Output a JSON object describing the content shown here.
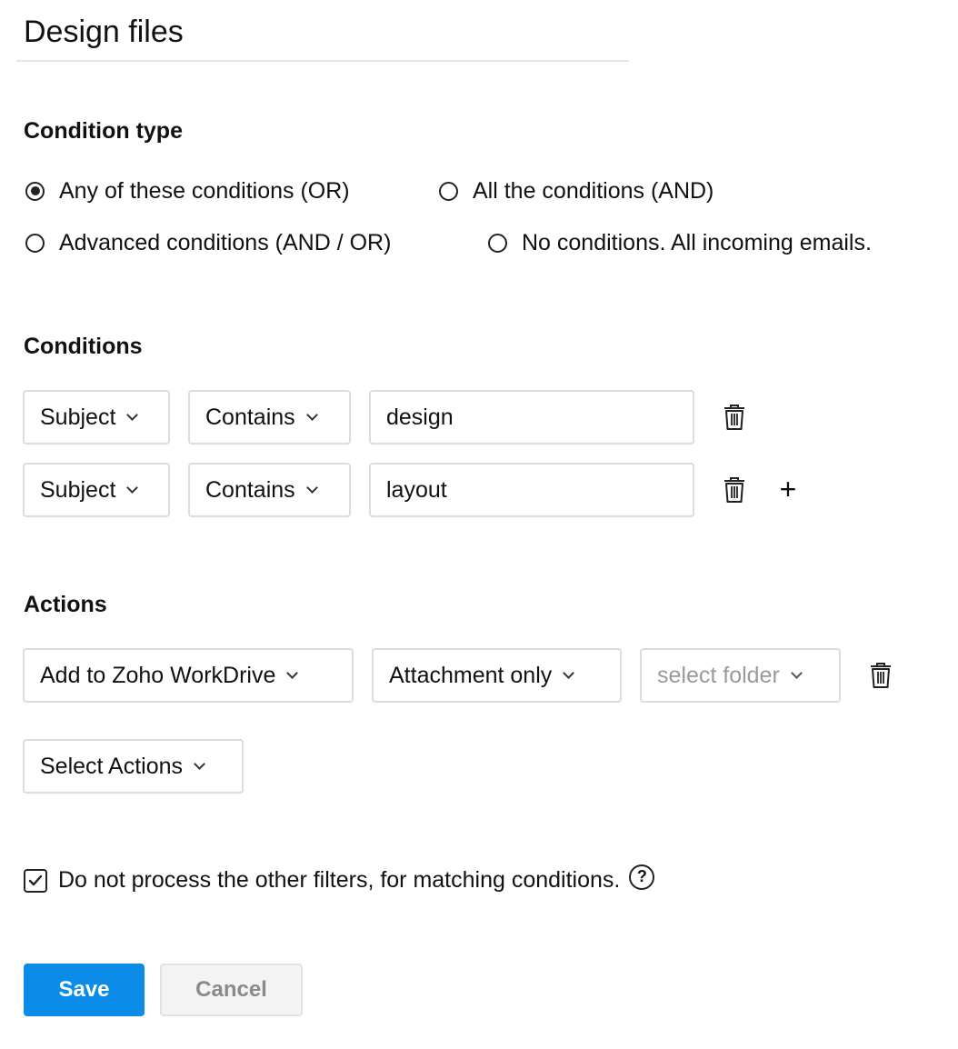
{
  "filter": {
    "name": "Design files"
  },
  "condition_type": {
    "title": "Condition type",
    "options": [
      {
        "label": "Any of these conditions (OR)",
        "checked": true
      },
      {
        "label": "All the conditions (AND)",
        "checked": false
      },
      {
        "label": "Advanced conditions (AND / OR)",
        "checked": false
      },
      {
        "label": "No conditions. All incoming emails.",
        "checked": false
      }
    ]
  },
  "conditions": {
    "title": "Conditions",
    "rows": [
      {
        "field": "Subject",
        "operator": "Contains",
        "value": "design"
      },
      {
        "field": "Subject",
        "operator": "Contains",
        "value": "layout"
      }
    ],
    "add_symbol": "+"
  },
  "actions": {
    "title": "Actions",
    "rows": [
      {
        "action": "Add to Zoho WorkDrive",
        "option": "Attachment only",
        "folder_placeholder": "select folder"
      }
    ],
    "select_label": "Select Actions"
  },
  "stop_processing": {
    "label": "Do not process the other filters, for matching conditions.",
    "checked": true,
    "help_symbol": "?"
  },
  "buttons": {
    "save": "Save",
    "cancel": "Cancel"
  },
  "colors": {
    "primary": "#0c8ce9",
    "border": "#dcdcdc",
    "placeholder": "#9a9a9a"
  },
  "icons": {
    "delete": "trash-icon",
    "add": "plus-icon",
    "dropdown": "chevron-down-icon",
    "help": "help-icon",
    "check": "check-icon"
  }
}
